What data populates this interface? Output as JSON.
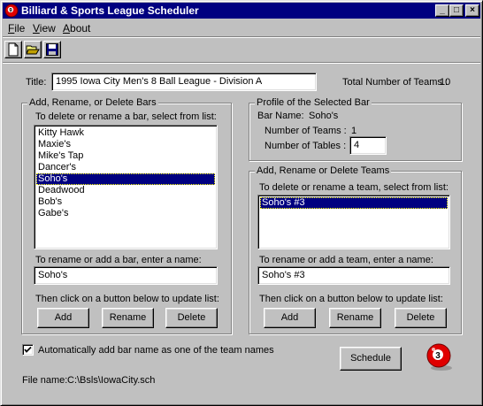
{
  "window": {
    "title": "Billiard & Sports League Scheduler",
    "controls": {
      "minimize": "_",
      "maximize": "□",
      "close": "×"
    },
    "app_icon": "billiard-ball-icon"
  },
  "menu": [
    {
      "label": "File",
      "underline": "F",
      "rest": "ile"
    },
    {
      "label": "View",
      "underline": "V",
      "rest": "iew"
    },
    {
      "label": "About",
      "underline": "A",
      "rest": "bout"
    }
  ],
  "toolbar": {
    "icons": [
      "new-file-icon",
      "open-folder-icon",
      "save-disk-icon"
    ]
  },
  "header": {
    "title_label": "Title:",
    "title_value": "1995 Iowa City Men's 8 Ball League - Division A",
    "total_teams_label": "Total Number of Teams :",
    "total_teams_value": "10"
  },
  "bars_group": {
    "title": "Add, Rename, or Delete Bars",
    "list_prompt": "To delete or rename a bar, select from list:",
    "items": [
      "Kitty Hawk",
      "Maxie's",
      "Mike's Tap",
      "Dancer's",
      "Soho's",
      "Deadwood",
      "Bob's",
      "Gabe's"
    ],
    "selected_index": 4,
    "name_prompt": "To rename or add a bar, enter a name:",
    "name_value": "Soho's",
    "update_prompt": "Then click on a button below to update list:",
    "add_label": "Add",
    "rename_label": "Rename",
    "delete_label": "Delete"
  },
  "profile_group": {
    "title": "Profile of the Selected Bar",
    "bar_name_label": "Bar Name:",
    "bar_name_value": "Soho's",
    "teams_label": "Number of Teams :",
    "teams_value": "1",
    "tables_label": "Number of Tables :",
    "tables_value": "4"
  },
  "teams_group": {
    "title": "Add, Rename or Delete Teams",
    "list_prompt": "To delete or rename a team, select from list:",
    "items": [
      "Soho's #3"
    ],
    "selected_index": 0,
    "name_prompt": "To rename or add a team, enter a name:",
    "name_value": "Soho's #3",
    "update_prompt": "Then click on a button below to update list:",
    "add_label": "Add",
    "rename_label": "Rename",
    "delete_label": "Delete"
  },
  "footer": {
    "auto_add_checked": true,
    "auto_add_label": "Automatically add bar name as one of the team names",
    "schedule_label": "Schedule",
    "ball_number": "3",
    "file_label": "File name:",
    "file_value": "C:\\Bsls\\IowaCity.sch"
  }
}
